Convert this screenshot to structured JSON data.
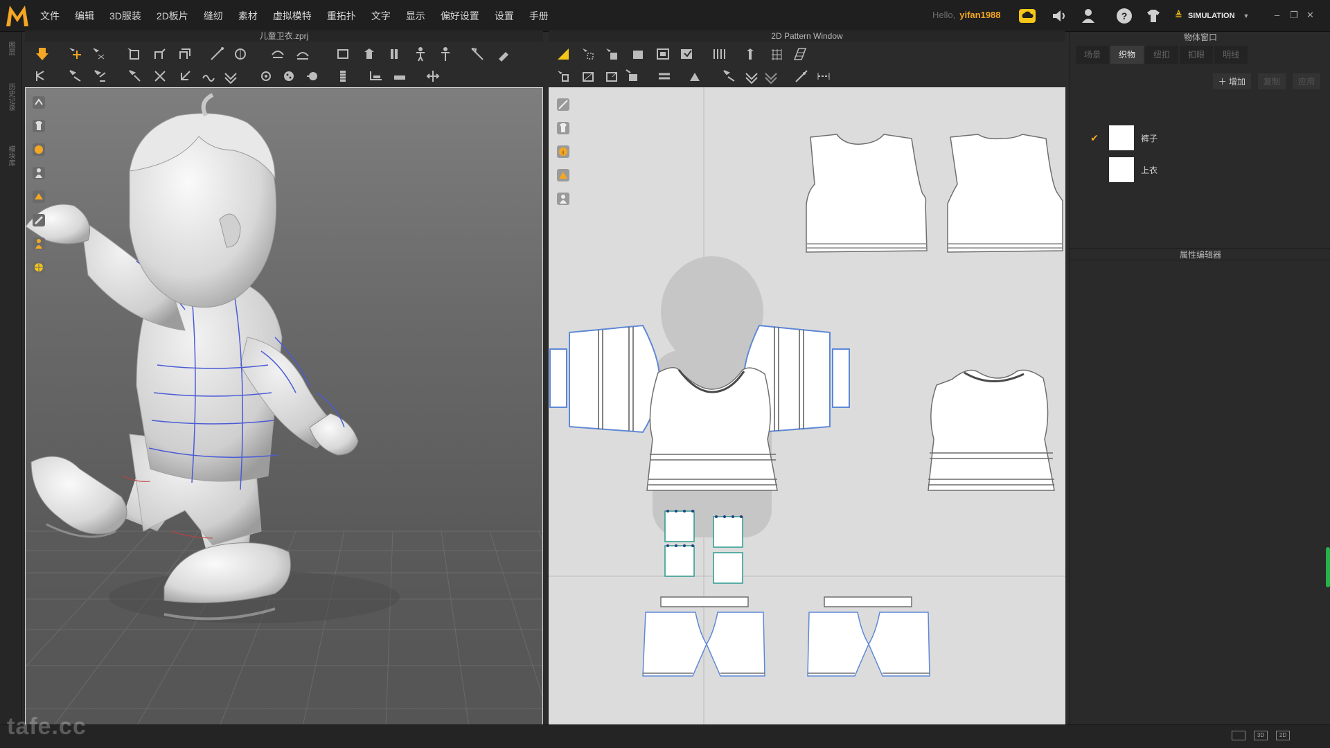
{
  "app": {
    "logo_letter": "M",
    "menus": [
      "文件",
      "编辑",
      "3D服装",
      "2D板片",
      "缝纫",
      "素材",
      "虚拟模特",
      "重拓扑",
      "文字",
      "显示",
      "偏好设置",
      "设置",
      "手册"
    ],
    "hello_label": "Hello,",
    "username": "yifan1988",
    "mode_label": "SIMULATION",
    "accent": "#f5a623"
  },
  "left_rail": {
    "tabs": [
      "图层",
      "历史记录",
      "模块库"
    ]
  },
  "viewport3d": {
    "title": "儿童卫衣.zprj",
    "bg": "#6a6a6a"
  },
  "viewport2d": {
    "title": "2D Pattern Window",
    "bg": "#dcdcdc"
  },
  "object_window": {
    "title": "物体窗口",
    "tabs": [
      "场景",
      "织物",
      "纽扣",
      "扣眼",
      "明线"
    ],
    "active_tab": "织物",
    "actions": {
      "add": "＋ 增加",
      "copy": "复制",
      "apply": "应用"
    },
    "fabrics": [
      {
        "name": "裤子",
        "checked": true
      },
      {
        "name": "上衣",
        "checked": false
      }
    ]
  },
  "property_editor": {
    "title": "属性编辑器"
  },
  "status": {
    "view_buttons": [
      "",
      "3D",
      "2D"
    ],
    "watermark": "tafe.cc"
  }
}
